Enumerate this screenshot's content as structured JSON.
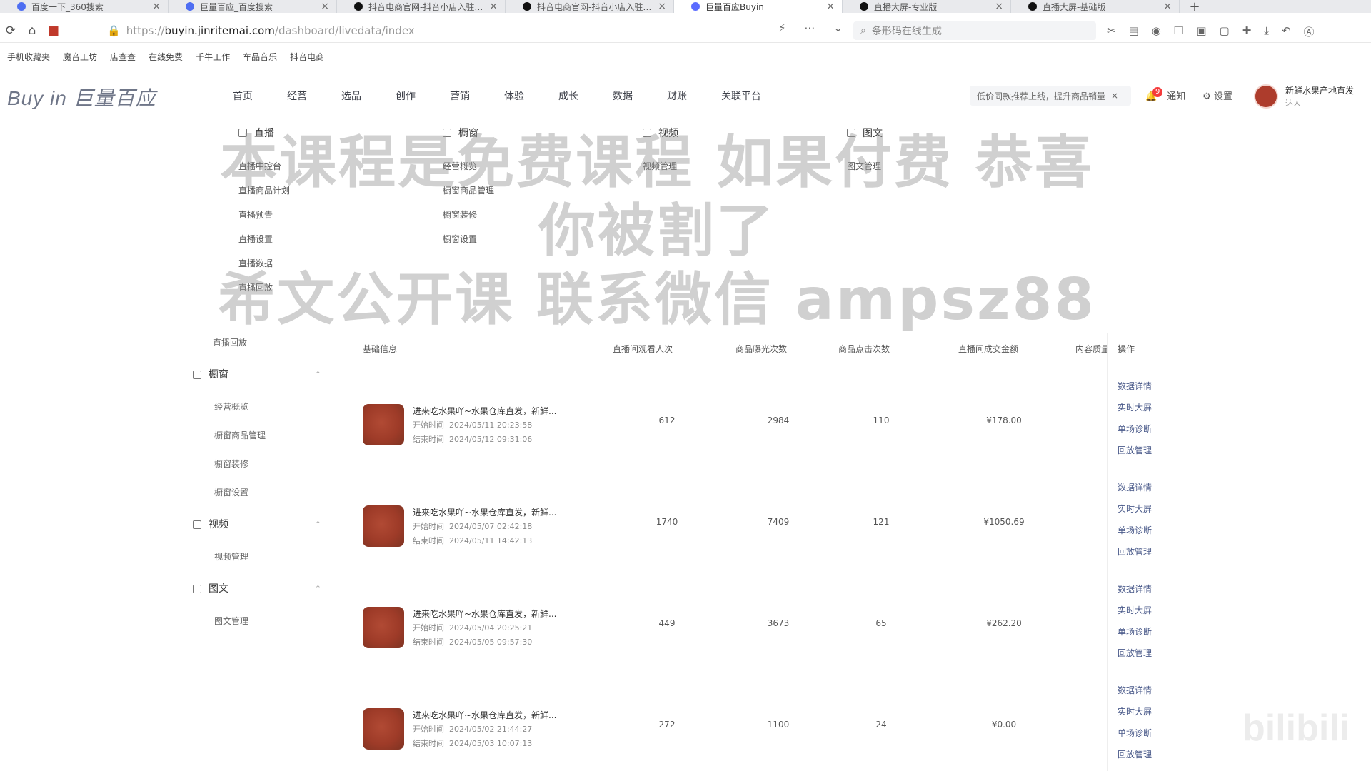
{
  "browser": {
    "tabs": [
      {
        "label": "百度一下_360搜索",
        "icon_color": "#4e6ef2",
        "active": false
      },
      {
        "label": "巨量百应_百度搜索",
        "icon_color": "#4e6ef2",
        "active": false
      },
      {
        "label": "抖音电商官网-抖音小店入驻-抖…",
        "icon_color": "#111111",
        "active": false
      },
      {
        "label": "抖音电商官网-抖音小店入驻-…",
        "icon_color": "#111111",
        "active": false
      },
      {
        "label": "巨量百应Buyin",
        "icon_color": "#5b6cff",
        "active": true
      },
      {
        "label": "直播大屏-专业版",
        "icon_color": "#111111",
        "active": false
      },
      {
        "label": "直播大屏-基础版",
        "icon_color": "#111111",
        "active": false
      }
    ],
    "new_tab": "+",
    "url_prefix": "https://",
    "url_host": "buyin.jinritemai.com",
    "url_path": "/dashboard/livedata/index",
    "search_placeholder": "条形码在线生成",
    "bookmarks": [
      "手机收藏夹",
      "魔音工坊",
      "店查查",
      "在线免费",
      "千牛工作",
      "车品音乐",
      "抖音电商"
    ]
  },
  "app": {
    "logo": "Buy in 巨量百应",
    "nav": [
      "首页",
      "经营",
      "选品",
      "创作",
      "营销",
      "体验",
      "成长",
      "数据",
      "财账",
      "关联平台"
    ],
    "promo": "低价同款推荐上线，提升商品销量",
    "notify_label": "通知",
    "notify_count": "9",
    "settings_label": "设置",
    "shop_name": "新鲜水果产地直发",
    "shop_sub": "达人"
  },
  "dropdown": {
    "columns": [
      {
        "title": "直播",
        "items": [
          "直播中控台",
          "直播商品计划",
          "直播预告",
          "直播设置",
          "直播数据",
          "直播回放"
        ]
      },
      {
        "title": "橱窗",
        "items": [
          "经营概览",
          "橱窗商品管理",
          "橱窗装修",
          "橱窗设置"
        ]
      },
      {
        "title": "视频",
        "items": [
          "视频管理"
        ]
      },
      {
        "title": "图文",
        "items": [
          "图文管理"
        ]
      }
    ]
  },
  "watermark": {
    "line1": "本课程是免费课程 如果付费 恭喜你被割了",
    "line2": "希文公开课 联系微信 ampsz88"
  },
  "sidebar": {
    "top_item": "直播回放",
    "groups": [
      {
        "title": "橱窗",
        "items": [
          "经营概览",
          "橱窗商品管理",
          "橱窗装修",
          "橱窗设置"
        ]
      },
      {
        "title": "视频",
        "items": [
          "视频管理"
        ]
      },
      {
        "title": "图文",
        "items": [
          "图文管理"
        ]
      }
    ]
  },
  "table": {
    "headers": {
      "basic": "基础信息",
      "viewers": "直播间观看人次",
      "exposure": "商品曝光次数",
      "clicks": "商品点击次数",
      "gmv": "直播间成交金额",
      "quality": "内容质量",
      "ops": "操作"
    },
    "rows": [
      {
        "title": "进来吃水果吖~水果仓库直发，新鲜...",
        "start_label": "开始时间",
        "start": "2024/05/11 20:23:58",
        "end_label": "结束时间",
        "end": "2024/05/12 09:31:06",
        "viewers": "612",
        "exposure": "2984",
        "clicks": "110",
        "gmv": "¥178.00"
      },
      {
        "title": "进来吃水果吖~水果仓库直发，新鲜...",
        "start_label": "开始时间",
        "start": "2024/05/07 02:42:18",
        "end_label": "结束时间",
        "end": "2024/05/11 14:42:13",
        "viewers": "1740",
        "exposure": "7409",
        "clicks": "121",
        "gmv": "¥1050.69"
      },
      {
        "title": "进来吃水果吖~水果仓库直发，新鲜...",
        "start_label": "开始时间",
        "start": "2024/05/04 20:25:21",
        "end_label": "结束时间",
        "end": "2024/05/05 09:57:30",
        "viewers": "449",
        "exposure": "3673",
        "clicks": "65",
        "gmv": "¥262.20"
      },
      {
        "title": "进来吃水果吖~水果仓库直发，新鲜...",
        "start_label": "开始时间",
        "start": "2024/05/02 21:44:27",
        "end_label": "结束时间",
        "end": "2024/05/03 10:07:13",
        "viewers": "272",
        "exposure": "1100",
        "clicks": "24",
        "gmv": "¥0.00"
      }
    ],
    "ops": [
      "数据详情",
      "实时大屏",
      "单场诊断",
      "回放管理"
    ]
  },
  "bilibili": "bilibili"
}
